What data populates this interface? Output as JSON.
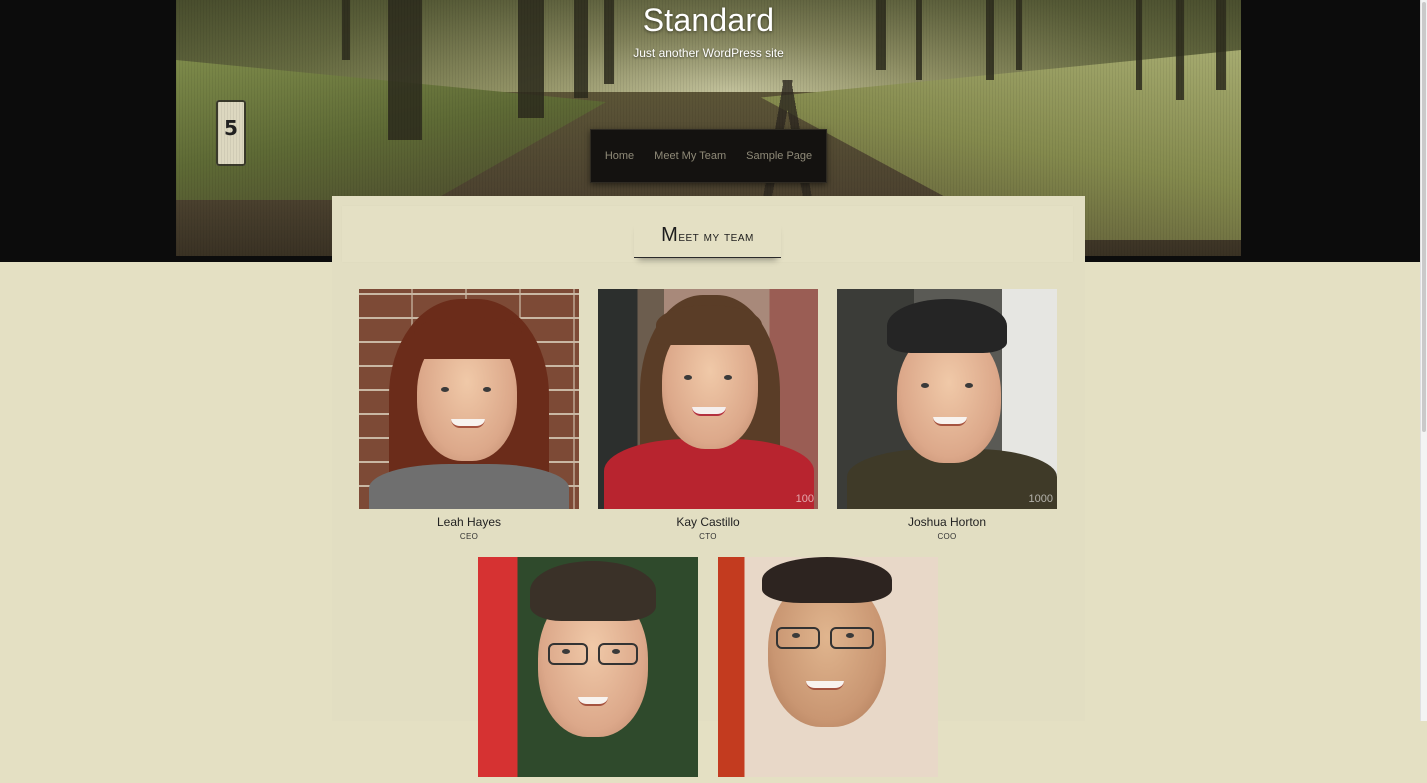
{
  "site": {
    "title": "Standard",
    "tagline": "Just another WordPress site"
  },
  "nav": {
    "items": [
      {
        "label": "Home"
      },
      {
        "label": "Meet My Team"
      },
      {
        "label": "Sample Page"
      }
    ]
  },
  "header_image": {
    "milepost_label": "5"
  },
  "page": {
    "title": "Meet my team"
  },
  "team": [
    {
      "name": "Leah Hayes",
      "role": "CEO"
    },
    {
      "name": "Kay Castillo",
      "role": "CTO",
      "photo_stamp": "100"
    },
    {
      "name": "Joshua Horton",
      "role": "COO",
      "photo_stamp": "1000"
    },
    {
      "name": "",
      "role": ""
    },
    {
      "name": "",
      "role": ""
    }
  ],
  "colors": {
    "page_background": "#e4e0c3",
    "header_band": "#0c0c0c",
    "nav_background": "#141210",
    "nav_text": "#8f8a78"
  }
}
